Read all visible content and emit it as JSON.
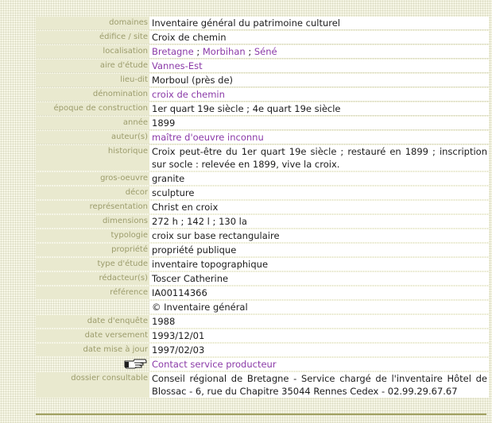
{
  "rows": [
    {
      "label": "domaines",
      "value": "Inventaire général du patrimoine culturel"
    },
    {
      "label": "édifice / site",
      "value": "Croix de chemin"
    },
    {
      "label": "localisation",
      "links": [
        "Bretagne",
        "Morbihan",
        "Séné"
      ],
      "separator": " ; "
    },
    {
      "label": "aire d'étude",
      "link": "Vannes-Est"
    },
    {
      "label": "lieu-dit",
      "value": "Morboul (près de)"
    },
    {
      "label": "dénomination",
      "link": "croix de chemin"
    },
    {
      "label": "époque de construction",
      "value": "1er quart 19e siècle ; 4e quart 19e siècle"
    },
    {
      "label": "année",
      "value": "1899"
    },
    {
      "label": "auteur(s)",
      "link": "maître d'oeuvre inconnu"
    },
    {
      "label": "historique",
      "value": "Croix peut-être du 1er quart 19e siècle ; restauré en 1899 ; inscription sur socle : relevée en 1899, vive la croix."
    },
    {
      "label": "gros-oeuvre",
      "value": "granite"
    },
    {
      "label": "décor",
      "value": "sculpture"
    },
    {
      "label": "représentation",
      "value": "Christ en croix"
    },
    {
      "label": "dimensions",
      "value": "272 h ; 142 l ; 130 la"
    },
    {
      "label": "typologie",
      "value": "croix sur base rectangulaire"
    },
    {
      "label": "propriété",
      "value": "propriété publique"
    },
    {
      "label": "type d'étude",
      "value": "inventaire topographique"
    },
    {
      "label": "rédacteur(s)",
      "value": "Toscer Catherine"
    },
    {
      "label": "référence",
      "value": "IA00114366"
    },
    {
      "label": "",
      "value": "© Inventaire général"
    },
    {
      "label": "date d'enquête",
      "value": "1988"
    },
    {
      "label": "date versement",
      "value": "1993/12/01"
    },
    {
      "label": "date mise à jour",
      "value": "1997/02/03"
    },
    {
      "label": "",
      "contact": "Contact service producteur",
      "icon": "pointing-hand-icon"
    },
    {
      "label": "dossier consultable",
      "value": "Conseil régional de Bretagne - Service chargé de l'inventaire Hôtel de Blossac - 6, rue du Chapitre 35044 Rennes Cedex - 02.99.29.67.67"
    }
  ],
  "colors": {
    "label_text": "#9c9c6c",
    "label_bg": "#e9e9cf",
    "link": "#8b3aa8",
    "rule": "#a0a060"
  }
}
